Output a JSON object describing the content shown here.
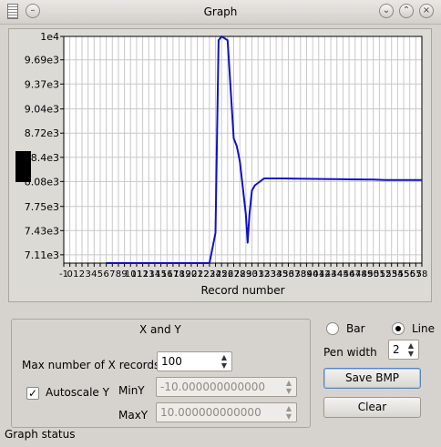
{
  "window": {
    "title": "Graph"
  },
  "chart_data": {
    "type": "line",
    "title": "",
    "xlabel": "Record number",
    "ylabel": "",
    "ylim": [
      7000,
      10000
    ],
    "xlim": [
      -1,
      58
    ],
    "ytick_labels": [
      "1e4",
      "9.69e3",
      "9.37e3",
      "9.04e3",
      "8.72e3",
      "8.4e3",
      "8.08e3",
      "7.75e3",
      "7.43e3",
      "7.11e3"
    ],
    "ytick_values": [
      10000,
      9690,
      9370,
      9040,
      8720,
      8400,
      8080,
      7750,
      7430,
      7110
    ],
    "xtick_labels": [
      "-1",
      "0",
      "1",
      "2",
      "3",
      "4",
      "5",
      "6",
      "7",
      "8",
      "9",
      "10",
      "11",
      "12",
      "13",
      "14",
      "15",
      "16",
      "17",
      "18",
      "19",
      "20",
      "21",
      "22",
      "23",
      "24",
      "25",
      "26",
      "27",
      "28",
      "29",
      "30",
      "31",
      "32",
      "33",
      "34",
      "35",
      "36",
      "37",
      "38",
      "39",
      "40",
      "41",
      "42",
      "43",
      "44",
      "45",
      "46",
      "47",
      "48",
      "49",
      "50",
      "51",
      "52",
      "53",
      "54",
      "55",
      "56",
      "57",
      "58"
    ],
    "grid": true,
    "line_color": "#1010c8",
    "series": [
      {
        "x": [
          6,
          10,
          15,
          20,
          23,
          24,
          24.5,
          25,
          26,
          27,
          27.5,
          28,
          28.5,
          29,
          29.3,
          29.6,
          30,
          30.5,
          31,
          32,
          33,
          35,
          40,
          45,
          50,
          52,
          55,
          58
        ],
        "y": [
          7000,
          7000,
          7000,
          7000,
          7000,
          7400,
          9950,
          10000,
          9950,
          8650,
          8550,
          8350,
          8000,
          7650,
          7270,
          7650,
          7960,
          8030,
          8060,
          8120,
          8120,
          8120,
          8115,
          8110,
          8105,
          8100,
          8100,
          8100
        ]
      }
    ]
  },
  "controls": {
    "group_title": "X and Y",
    "max_records_label": "Max number of X records",
    "max_records_value": "100",
    "autoscale_label": "Autoscale Y",
    "autoscale_checked": "✓",
    "miny_label": "MinY",
    "miny_value": "-10.000000000000",
    "maxy_label": "MaxY",
    "maxy_value": "10.000000000000",
    "bar_label": "Bar",
    "line_label": "Line",
    "pen_width_label": "Pen width",
    "pen_width_value": "2",
    "save_bmp_label": "Save BMP",
    "clear_label": "Clear"
  },
  "status": {
    "text": "Graph status"
  }
}
